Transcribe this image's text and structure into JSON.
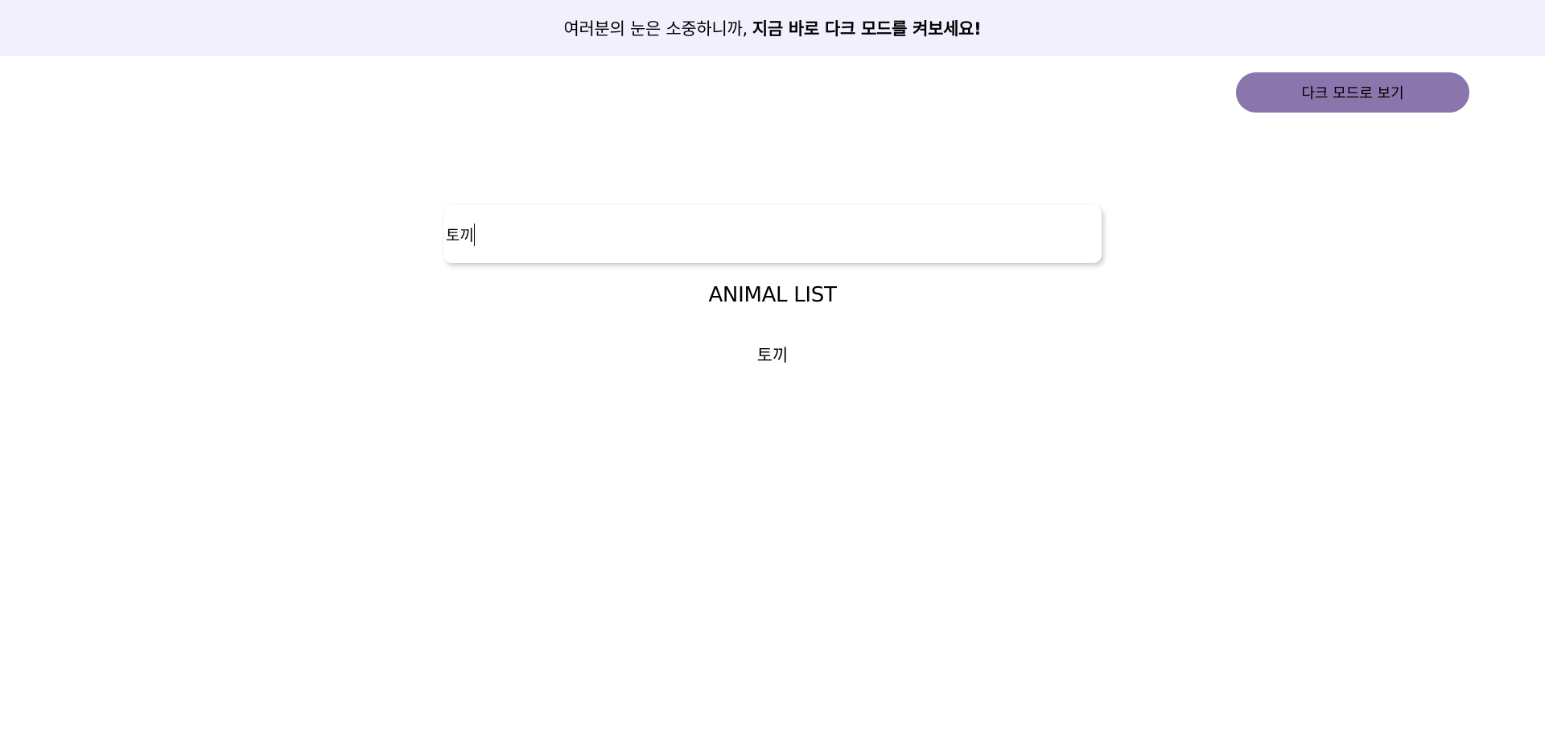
{
  "banner": {
    "normal_text": "여러분의 눈은 소중하니까,",
    "strong_text": "지금 바로 다크 모드를 켜보세요!"
  },
  "dark_mode_button": {
    "label": "다크 모드로 보기"
  },
  "search": {
    "value": "토끼"
  },
  "animal_list": {
    "title": "ANIMAL LIST",
    "items": [
      "토끼"
    ]
  },
  "colors": {
    "banner_bg": "#f2f0fd",
    "button_bg": "#8a76ad"
  }
}
